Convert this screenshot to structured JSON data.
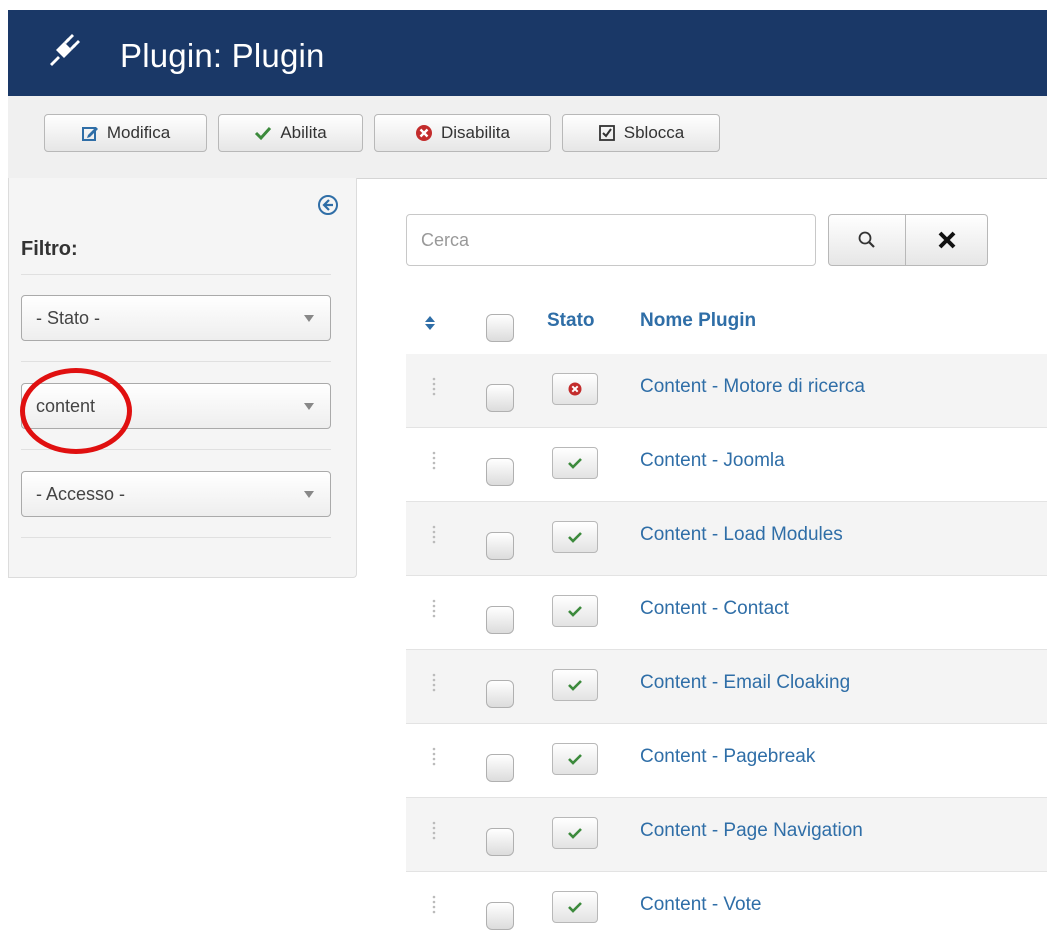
{
  "header": {
    "title": "Plugin: Plugin"
  },
  "toolbar": {
    "modifica": "Modifica",
    "abilita": "Abilita",
    "disabilita": "Disabilita",
    "sblocca": "Sblocca"
  },
  "sidebar": {
    "filter_label": "Filtro:",
    "state_select": "- Stato -",
    "type_select": "content",
    "access_select": "- Accesso -"
  },
  "search": {
    "placeholder": "Cerca"
  },
  "table": {
    "col_state": "Stato",
    "col_name": "Nome Plugin",
    "rows": [
      {
        "name": "Content - Motore di ricerca",
        "status": "disabled"
      },
      {
        "name": "Content - Joomla",
        "status": "enabled"
      },
      {
        "name": "Content - Load Modules",
        "status": "enabled"
      },
      {
        "name": "Content - Contact",
        "status": "enabled"
      },
      {
        "name": "Content - Email Cloaking",
        "status": "enabled"
      },
      {
        "name": "Content - Pagebreak",
        "status": "enabled"
      },
      {
        "name": "Content - Page Navigation",
        "status": "enabled"
      },
      {
        "name": "Content - Vote",
        "status": "enabled"
      }
    ]
  },
  "colors": {
    "header_bg": "#1a3867",
    "link": "#2f6ea7",
    "enabled_check": "#3c8a3c",
    "disabled_x": "#c32c2c",
    "highlight": "#e01010"
  }
}
